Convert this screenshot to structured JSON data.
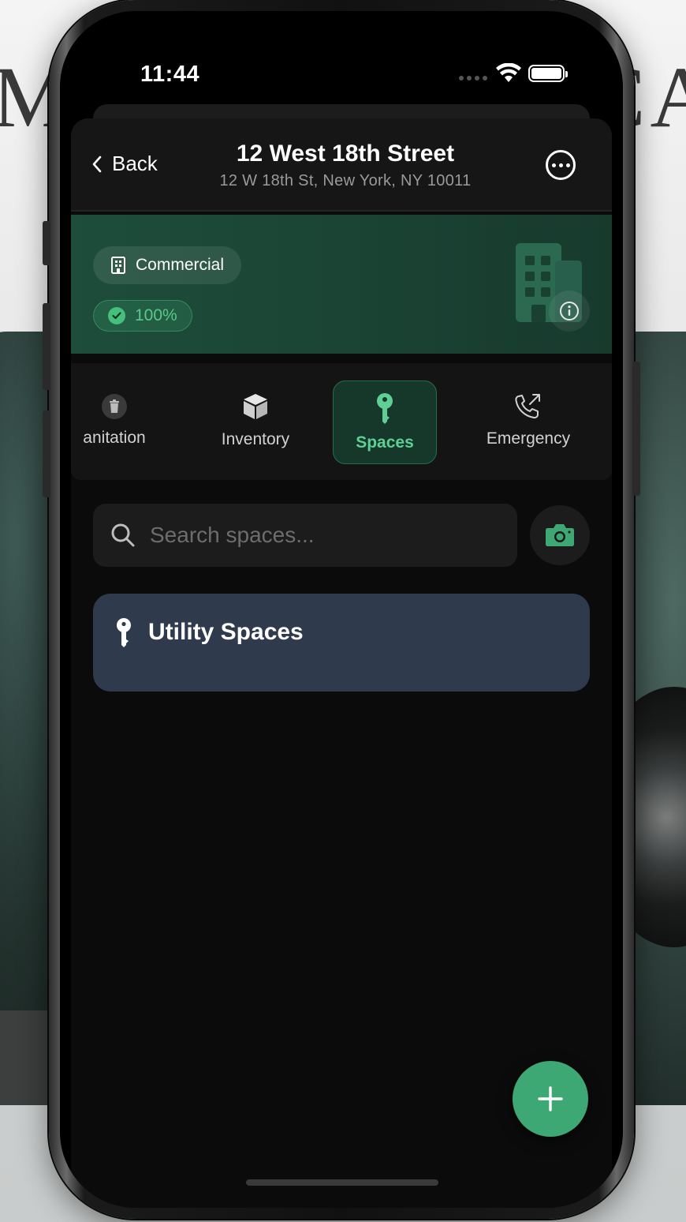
{
  "status_bar": {
    "time": "11:44"
  },
  "header": {
    "back_label": "Back",
    "title": "12 West 18th Street",
    "subtitle": "12 W 18th St, New York, NY 10011"
  },
  "property": {
    "type_label": "Commercial",
    "completion": "100%"
  },
  "tabs": [
    {
      "label": "anitation",
      "icon": "trash-icon",
      "active": false
    },
    {
      "label": "Inventory",
      "icon": "box-icon",
      "active": false
    },
    {
      "label": "Spaces",
      "icon": "key-icon",
      "active": true
    },
    {
      "label": "Emergency",
      "icon": "phone-outgoing-icon",
      "active": false
    }
  ],
  "search": {
    "placeholder": "Search spaces..."
  },
  "spaces": [
    {
      "label": "Utility Spaces",
      "icon": "key-icon"
    }
  ],
  "colors": {
    "accent": "#3ea875",
    "banner": "#1e4d3b",
    "card": "#2f3a4c"
  }
}
